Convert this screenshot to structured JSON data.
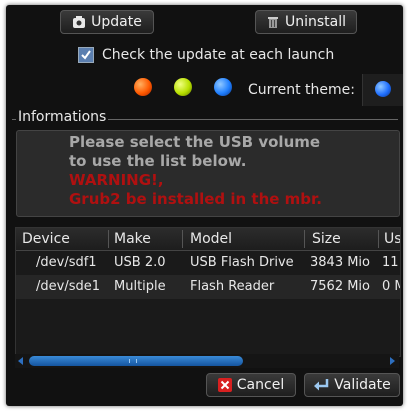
{
  "toolbar": {
    "update_label": "Update",
    "uninstall_label": "Uninstall"
  },
  "options": {
    "check_update_label": "Check the update at each launch",
    "check_update_checked": true
  },
  "themes": {
    "current_label": "Current theme:",
    "colors": [
      "#ff5a00",
      "#b8e000",
      "#1f7fff"
    ],
    "current_color": "#1f6fff"
  },
  "info": {
    "group_label": "Informations",
    "line1": "Please select the USB volume",
    "line2": "to use the list below.",
    "warning1": "WARNING!,",
    "warning2": "Grub2 be installed in the mbr."
  },
  "table": {
    "headers": [
      "Device",
      "Make",
      "Model",
      "Size",
      "Us"
    ],
    "rows": [
      [
        "/dev/sdf1",
        "USB 2.0",
        "USB Flash Drive",
        "3843 Mio",
        "11"
      ],
      [
        "/dev/sde1",
        "Multiple",
        "Flash Reader",
        "7562 Mio",
        "0 M"
      ]
    ]
  },
  "actions": {
    "cancel_label": "Cancel",
    "validate_label": "Validate"
  }
}
